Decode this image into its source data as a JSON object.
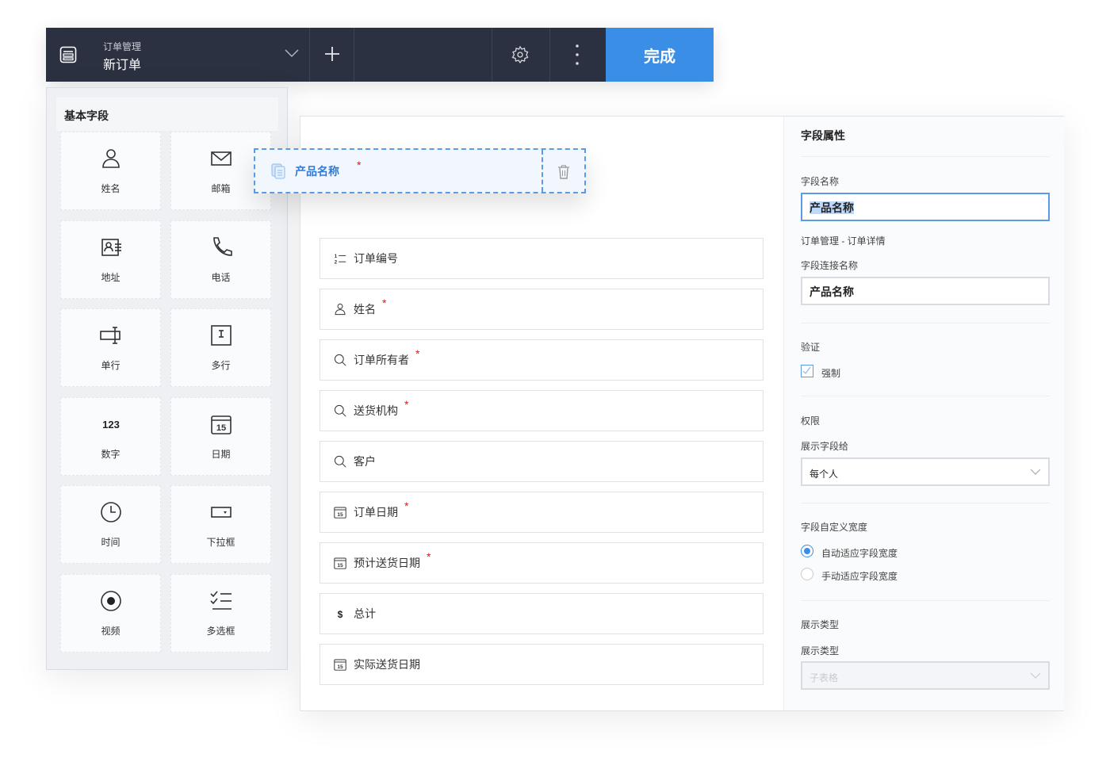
{
  "topbar": {
    "module": "订单管理",
    "title": "新订单",
    "done_label": "完成"
  },
  "palette": {
    "title": "基本字段",
    "tiles": [
      {
        "label": "姓名",
        "icon": "person-icon"
      },
      {
        "label": "邮箱",
        "icon": "envelope-icon"
      },
      {
        "label": "地址",
        "icon": "address-card-icon"
      },
      {
        "label": "电话",
        "icon": "phone-icon"
      },
      {
        "label": "单行",
        "icon": "single-line-icon"
      },
      {
        "label": "多行",
        "icon": "multi-line-icon"
      },
      {
        "label": "数字",
        "icon": "number-icon",
        "glyph": "123"
      },
      {
        "label": "日期",
        "icon": "calendar-icon",
        "glyph": "15"
      },
      {
        "label": "时间",
        "icon": "clock-icon"
      },
      {
        "label": "下拉框",
        "icon": "dropdown-icon"
      },
      {
        "label": "视频",
        "icon": "radio-icon"
      },
      {
        "label": "多选框",
        "icon": "checklist-icon"
      }
    ]
  },
  "drag": {
    "label": "产品名称",
    "required": "*"
  },
  "fields": [
    {
      "label": "订单编号",
      "icon": "numbered-list-icon",
      "required": false
    },
    {
      "label": "姓名",
      "icon": "person-icon",
      "required": true
    },
    {
      "label": "订单所有者",
      "icon": "search-icon",
      "required": true
    },
    {
      "label": "送货机构",
      "icon": "search-icon",
      "required": true
    },
    {
      "label": "客户",
      "icon": "search-icon",
      "required": false
    },
    {
      "label": "订单日期",
      "icon": "calendar-icon",
      "required": true
    },
    {
      "label": "预计送货日期",
      "icon": "calendar-icon",
      "required": true
    },
    {
      "label": "总计",
      "icon": "dollar-icon",
      "required": false
    },
    {
      "label": "实际送货日期",
      "icon": "calendar-icon",
      "required": false
    }
  ],
  "required_mark": "*",
  "props": {
    "title": "字段属性",
    "field_name_label": "字段名称",
    "field_name_value": "产品名称",
    "context": "订单管理 - 订单详情",
    "link_name_label": "字段连接名称",
    "link_name_value": "产品名称",
    "validation_label": "验证",
    "mandatory_label": "强制",
    "mandatory_checked": true,
    "permission_label": "权限",
    "show_to_label": "展示字段给",
    "show_to_value": "每个人",
    "width_label": "字段自定义宽度",
    "width_auto": "自动适应字段宽度",
    "width_manual": "手动适应字段宽度",
    "width_selected": "auto",
    "display_section": "展示类型",
    "display_label": "展示类型",
    "display_value": "子表格"
  },
  "colors": {
    "accent": "#3a8ee6",
    "topbar": "#2b3141",
    "required": "#ee1111"
  }
}
